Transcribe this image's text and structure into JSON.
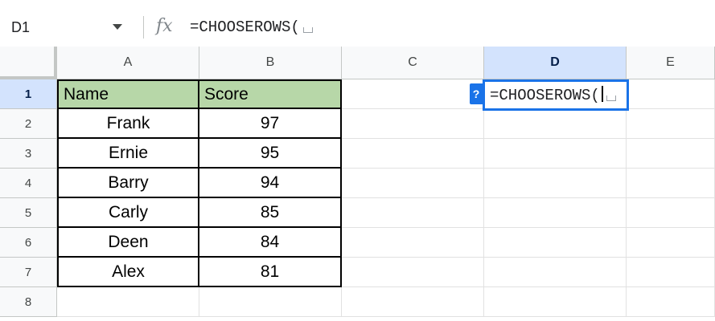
{
  "formula_bar": {
    "name_box": "D1",
    "fx_label": "fx",
    "formula": "=CHOOSEROWS("
  },
  "columns": [
    "A",
    "B",
    "C",
    "D",
    "E"
  ],
  "active_column": "D",
  "rows": [
    "1",
    "2",
    "3",
    "4",
    "5",
    "6",
    "7",
    "8"
  ],
  "active_row": "1",
  "table": {
    "headers": [
      "Name",
      "Score"
    ],
    "records": [
      {
        "name": "Frank",
        "score": "97"
      },
      {
        "name": "Ernie",
        "score": "95"
      },
      {
        "name": "Barry",
        "score": "94"
      },
      {
        "name": "Carly",
        "score": "85"
      },
      {
        "name": "Deen",
        "score": "84"
      },
      {
        "name": "Alex",
        "score": "81"
      }
    ]
  },
  "editor": {
    "text": "=CHOOSEROWS(",
    "help_label": "?"
  },
  "colors": {
    "header_fill": "#b7d7a8",
    "selection": "#1a73e8",
    "active_header": "#d3e3fd"
  }
}
